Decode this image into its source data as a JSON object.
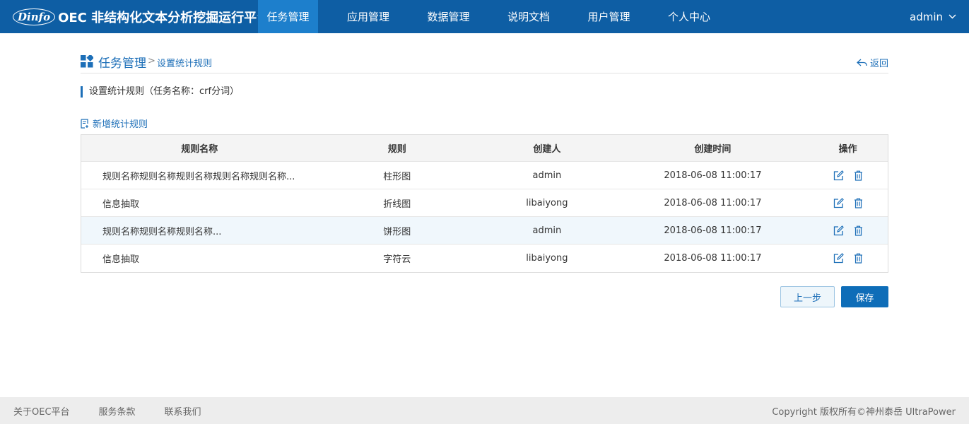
{
  "header": {
    "logo_text": "Dinfo",
    "app_title": "OEC 非结构化文本分析挖掘运行平台",
    "nav": [
      {
        "label": "任务管理",
        "active": true
      },
      {
        "label": "应用管理",
        "active": false
      },
      {
        "label": "数据管理",
        "active": false
      },
      {
        "label": "说明文档",
        "active": false
      },
      {
        "label": "用户管理",
        "active": false
      },
      {
        "label": "个人中心",
        "active": false
      }
    ],
    "user": "admin"
  },
  "breadcrumb": {
    "main": "任务管理",
    "separator": ">",
    "sub": "设置统计规则",
    "back_label": "返回"
  },
  "section": {
    "title": "设置统计规则（任务名称：crf分词）",
    "add_label": "新增统计规则"
  },
  "table": {
    "columns": [
      "规则名称",
      "规则",
      "创建人",
      "创建时间",
      "操作"
    ],
    "rows": [
      {
        "name": "规则名称规则名称规则名称规则名称规则名称...",
        "rule": "柱形图",
        "creator": "admin",
        "time": "2018-06-08 11:00:17"
      },
      {
        "name": "信息抽取",
        "rule": "折线图",
        "creator": "libaiyong",
        "time": "2018-06-08 11:00:17"
      },
      {
        "name": "规则名称规则名称规则名称...",
        "rule": "饼形图",
        "creator": "admin",
        "time": "2018-06-08 11:00:17"
      },
      {
        "name": "信息抽取",
        "rule": "字符云",
        "creator": "libaiyong",
        "time": "2018-06-08 11:00:17"
      }
    ]
  },
  "buttons": {
    "prev": "上一步",
    "save": "保存"
  },
  "footer": {
    "links": [
      "关于OEC平台",
      "服务条款",
      "联系我们"
    ],
    "copyright": "Copyright 版权所有©神州泰岳 UltraPower"
  },
  "colors": {
    "header_bg": "#0e5ea4",
    "nav_active": "#1d7fcc",
    "accent": "#1d6fb8",
    "footer_bg": "#ededed"
  }
}
